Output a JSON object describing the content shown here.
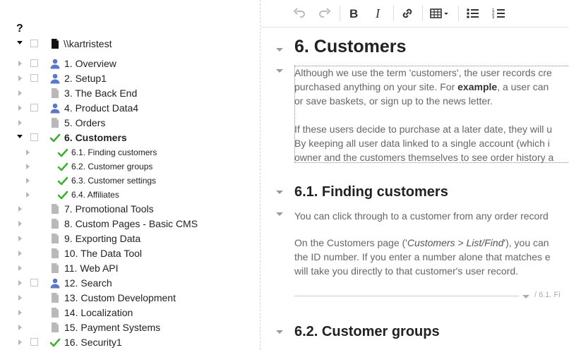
{
  "tree": {
    "help_label": "?",
    "root": {
      "label": "\\\\kartristest"
    },
    "items": [
      {
        "label": "1. Overview",
        "icon": "user-icon",
        "expanded": false,
        "checkbox": true,
        "bold": false,
        "small": false
      },
      {
        "label": "2. Setup1",
        "icon": "user-icon",
        "expanded": false,
        "checkbox": true,
        "bold": false,
        "small": false
      },
      {
        "label": "3. The Back End",
        "icon": "document-icon",
        "expanded": false,
        "checkbox": false,
        "bold": false,
        "small": false
      },
      {
        "label": "4. Product Data4",
        "icon": "user-icon",
        "expanded": false,
        "checkbox": true,
        "bold": false,
        "small": false
      },
      {
        "label": "5. Orders",
        "icon": "document-icon",
        "expanded": false,
        "checkbox": false,
        "bold": false,
        "small": false
      },
      {
        "label": "6. Customers",
        "icon": "check-icon",
        "expanded": true,
        "checkbox": true,
        "bold": true,
        "small": false
      },
      {
        "label": "6.1. Finding customers",
        "icon": "check-icon",
        "expanded": false,
        "checkbox": false,
        "bold": false,
        "small": true,
        "child": true
      },
      {
        "label": "6.2. Customer groups",
        "icon": "check-icon",
        "expanded": false,
        "checkbox": false,
        "bold": false,
        "small": true,
        "child": true
      },
      {
        "label": "6.3. Customer settings",
        "icon": "check-icon",
        "expanded": false,
        "checkbox": false,
        "bold": false,
        "small": true,
        "child": true
      },
      {
        "label": "6.4. Affiliates",
        "icon": "check-icon",
        "expanded": false,
        "checkbox": false,
        "bold": false,
        "small": true,
        "child": true
      },
      {
        "label": "7. Promotional Tools",
        "icon": "document-icon",
        "expanded": false,
        "checkbox": false,
        "bold": false,
        "small": false
      },
      {
        "label": "8. Custom Pages - Basic CMS",
        "icon": "document-icon",
        "expanded": false,
        "checkbox": false,
        "bold": false,
        "small": false
      },
      {
        "label": "9. Exporting Data",
        "icon": "document-icon",
        "expanded": false,
        "checkbox": false,
        "bold": false,
        "small": false
      },
      {
        "label": "10. The Data Tool",
        "icon": "document-icon",
        "expanded": false,
        "checkbox": false,
        "bold": false,
        "small": false
      },
      {
        "label": "11. Web API",
        "icon": "document-icon",
        "expanded": false,
        "checkbox": false,
        "bold": false,
        "small": false
      },
      {
        "label": "12. Search",
        "icon": "user-icon",
        "expanded": false,
        "checkbox": true,
        "bold": false,
        "small": false
      },
      {
        "label": "13. Custom Development",
        "icon": "document-icon",
        "expanded": false,
        "checkbox": false,
        "bold": false,
        "small": false
      },
      {
        "label": "14. Localization",
        "icon": "document-icon",
        "expanded": false,
        "checkbox": false,
        "bold": false,
        "small": false
      },
      {
        "label": "15. Payment Systems",
        "icon": "document-icon",
        "expanded": false,
        "checkbox": false,
        "bold": false,
        "small": false
      },
      {
        "label": "16. Security1",
        "icon": "check-icon",
        "expanded": false,
        "checkbox": true,
        "bold": false,
        "small": false
      }
    ]
  },
  "toolbar": {
    "buttons": [
      "undo-icon",
      "redo-icon",
      "bold-icon",
      "italic-icon",
      "link-icon",
      "table-icon",
      "bullet-list-icon",
      "numbered-list-icon"
    ]
  },
  "doc": {
    "h1": "6.  Customers",
    "p1": {
      "line1": "Although we use the term 'customers', the user records cre",
      "line2_pre": "purchased anything on your site. For ",
      "line2_bold": "example",
      "line2_post": ", a user can",
      "line3": "or save baskets, or sign up to the news letter.",
      "line4": "If these users decide to purchase at a later date, they will u",
      "line5": "By keeping all user data linked to a single account (which i",
      "line6": "owner and the customers themselves to see order history a"
    },
    "h2a": "6.1.  Finding customers",
    "p2": "You can click through to a customer from any order record",
    "p3": {
      "line1_pre": "On the Customers page ('",
      "line1_em": "Customers > List/Find",
      "line1_post": "'), you can",
      "line2": "the ID number. If you enter a number alone that matches e",
      "line3": "will take you directly to that customer's user record."
    },
    "crumb": "/ 6.1. Fi",
    "h2b": "6.2.  Customer groups"
  }
}
